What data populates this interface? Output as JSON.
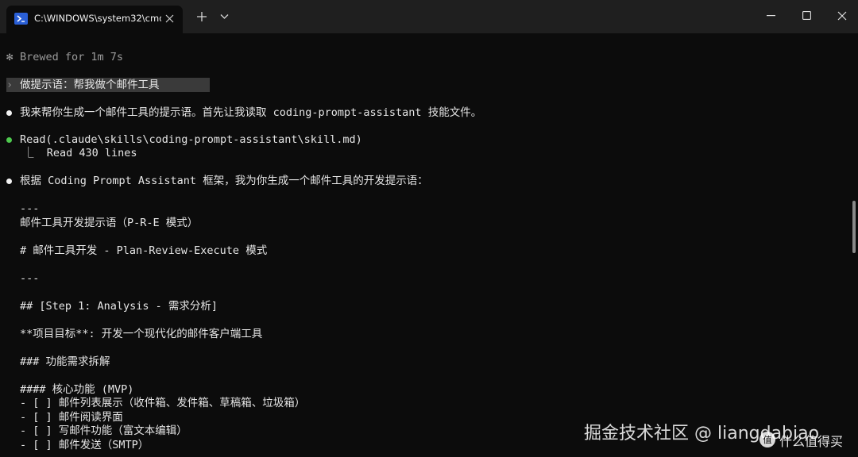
{
  "window": {
    "tab_title": "C:\\WINDOWS\\system32\\cmd.",
    "tab_icon": "powershell-icon",
    "new_tab_icon": "plus-icon",
    "dropdown_icon": "chevron-down-icon",
    "controls": [
      "minimize-icon",
      "maximize-icon",
      "close-icon"
    ]
  },
  "terminal": {
    "brewed_star": "✻",
    "brewed": "Brewed for 1m 7s",
    "prompt_chevron": "›",
    "prompt": "做提示语：帮我做个邮件工具",
    "response1": "我来帮你生成一个邮件工具的提示语。首先让我读取 coding-prompt-assistant 技能文件。",
    "tool_call": "Read(.claude\\skills\\coding-prompt-assistant\\skill.md)",
    "tool_result": "⎿  Read 430 lines",
    "response2": "根据 Coding Prompt Assistant 框架，我为你生成一个邮件工具的开发提示语：",
    "body_lines": [
      "---",
      "邮件工具开发提示语（P-R-E 模式）",
      "# 邮件工具开发 - Plan-Review-Execute 模式",
      "---",
      "## [Step 1: Analysis - 需求分析]",
      "**项目目标**: 开发一个现代化的邮件客户端工具",
      "### 功能需求拆解",
      "#### 核心功能 (MVP)",
      "- [ ] 邮件列表展示（收件箱、发件箱、草稿箱、垃圾箱）",
      "- [ ] 邮件阅读界面",
      "- [ ] 写邮件功能（富文本编辑）",
      "- [ ] 邮件发送（SMTP）"
    ]
  },
  "watermark": {
    "text": "掘金技术社区 @ liangdabiao",
    "site": "什么值得买"
  },
  "colors": {
    "background": "#0c0c0c",
    "titlebar": "#1f1f1f",
    "tool_dot": "#4ec94e"
  }
}
